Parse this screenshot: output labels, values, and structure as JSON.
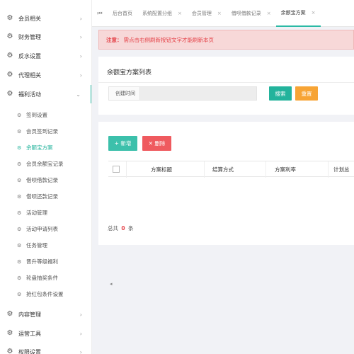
{
  "sidebar": {
    "top_items": [
      {
        "label": "会员相关",
        "icon": "gear-icon"
      },
      {
        "label": "财务管理",
        "icon": "gear-icon"
      },
      {
        "label": "反水设置",
        "icon": "gear-icon"
      },
      {
        "label": "代理相关",
        "icon": "gear-icon"
      },
      {
        "label": "福利活动",
        "icon": "gear-icon"
      }
    ],
    "sub_items": [
      {
        "label": "签到设置"
      },
      {
        "label": "会员签到记录"
      },
      {
        "label": "余额宝方案"
      },
      {
        "label": "会员余额宝记录"
      },
      {
        "label": "借呗借款记录"
      },
      {
        "label": "借呗还款记录"
      },
      {
        "label": "活动管理"
      },
      {
        "label": "活动申请列表"
      },
      {
        "label": "任务管理"
      },
      {
        "label": "晋升等级福利"
      },
      {
        "label": "轮盘抽奖条件"
      },
      {
        "label": "抢红包条件设置"
      }
    ],
    "bottom_items": [
      {
        "label": "内容管理",
        "icon": "gear-icon"
      },
      {
        "label": "运营工具",
        "icon": "gear-icon"
      },
      {
        "label": "权限设置",
        "icon": "gear-icon"
      }
    ],
    "active_sub": "余额宝方案",
    "accent_color": "#23b39c"
  },
  "tabs": [
    {
      "label": "后台首页"
    },
    {
      "label": "系统配置分组"
    },
    {
      "label": "会员管理"
    },
    {
      "label": "借呗借款记录"
    },
    {
      "label": "余额宝方案"
    }
  ],
  "notice": {
    "prefix": "注意：",
    "text": "需点击右侧刷新按钮文字才能刷新本页"
  },
  "search_card": {
    "title": "余额宝方案列表",
    "field_label": "创建时间",
    "field_value": "",
    "search_label": "搜索",
    "reset_label": "重置"
  },
  "table_card": {
    "add_label": "+ 新增",
    "delete_label": "✕ 删除",
    "columns": [
      "方案标题",
      "结算方式",
      "方案利率",
      "计划总"
    ],
    "total_prefix": "总共",
    "total_count": "0",
    "total_suffix": "条"
  },
  "colors": {
    "search_button": "#23b39c",
    "reset_button": "#f7a435",
    "add_button": "#3cc0ab",
    "delete_button": "#ef5a5f",
    "notice_text": "#e5444a",
    "notice_bg": "#f7d8d8"
  }
}
